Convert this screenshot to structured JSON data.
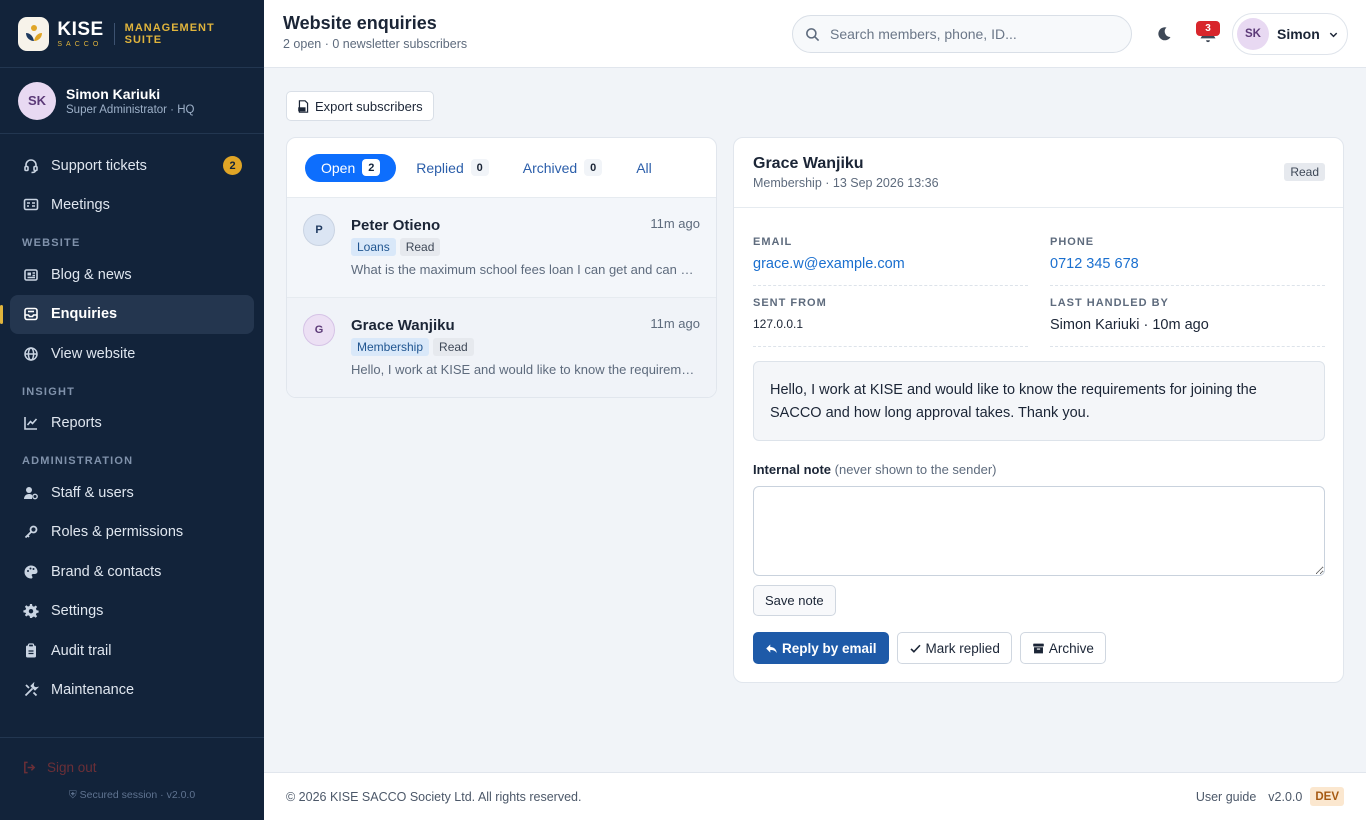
{
  "brand": {
    "name": "KISE",
    "sub": "SACCO",
    "suite": "MANAGEMENT SUITE"
  },
  "profile": {
    "initials": "SK",
    "name": "Simon Kariuki",
    "role": "Super Administrator · HQ"
  },
  "nav": {
    "support": {
      "label": "Support tickets",
      "badge": "2"
    },
    "meetings": {
      "label": "Meetings"
    },
    "section_website": "WEBSITE",
    "blog": {
      "label": "Blog & news"
    },
    "enquiries": {
      "label": "Enquiries"
    },
    "view_website": {
      "label": "View website"
    },
    "section_insight": "INSIGHT",
    "reports": {
      "label": "Reports"
    },
    "section_admin": "ADMINISTRATION",
    "staff": {
      "label": "Staff & users"
    },
    "roles": {
      "label": "Roles & permissions"
    },
    "brand_contacts": {
      "label": "Brand & contacts"
    },
    "settings": {
      "label": "Settings"
    },
    "audit": {
      "label": "Audit trail"
    },
    "maintenance": {
      "label": "Maintenance"
    }
  },
  "sidebar_footer": {
    "signout": "Sign out",
    "secured": "Secured session · v2.0.0"
  },
  "header": {
    "title": "Website enquiries",
    "subtitle": "2 open · 0 newsletter subscribers",
    "search_placeholder": "Search members, phone, ID...",
    "notifications": "3",
    "user_initials": "SK",
    "user_name": "Simon"
  },
  "toolbar": {
    "export_label": "Export subscribers"
  },
  "tabs": [
    {
      "label": "Open",
      "count": "2"
    },
    {
      "label": "Replied",
      "count": "0"
    },
    {
      "label": "Archived",
      "count": "0"
    },
    {
      "label": "All"
    }
  ],
  "enquiries": [
    {
      "initial": "P",
      "name": "Peter Otieno",
      "time": "11m ago",
      "category": "Loans",
      "status": "Read",
      "preview": "What is the maximum school fees loan I can get and can I repay it over twelve months?"
    },
    {
      "initial": "G",
      "name": "Grace Wanjiku",
      "time": "11m ago",
      "category": "Membership",
      "status": "Read",
      "preview": "Hello, I work at KISE and would like to know the requirements for joining the SACCO and how long approval takes."
    }
  ],
  "detail": {
    "name": "Grace Wanjiku",
    "meta": "Membership · 13 Sep 2026 13:36",
    "status": "Read",
    "email_label": "EMAIL",
    "email": "grace.w@example.com",
    "phone_label": "PHONE",
    "phone": "0712 345 678",
    "sent_from_label": "SENT FROM",
    "sent_from": "127.0.0.1",
    "handled_label": "LAST HANDLED BY",
    "handled_by": "Simon Kariuki · 10m ago",
    "message": "Hello, I work at KISE and would like to know the requirements for joining the SACCO and how long approval takes. Thank you.",
    "note_label": "Internal note",
    "note_hint": "(never shown to the sender)",
    "note_value": "",
    "save_note": "Save note",
    "reply": "Reply by email",
    "mark_replied": "Mark replied",
    "archive": "Archive"
  },
  "footer": {
    "copyright": "© 2026 KISE SACCO Society Ltd. All rights reserved.",
    "guide": "User guide",
    "version": "v2.0.0",
    "env": "DEV"
  },
  "colors": {
    "sidebar_bg": "#12233a",
    "accent_gold": "#e0b43c",
    "primary_blue": "#0d6efd",
    "button_blue": "#1e5aa8",
    "danger": "#d8262c"
  }
}
